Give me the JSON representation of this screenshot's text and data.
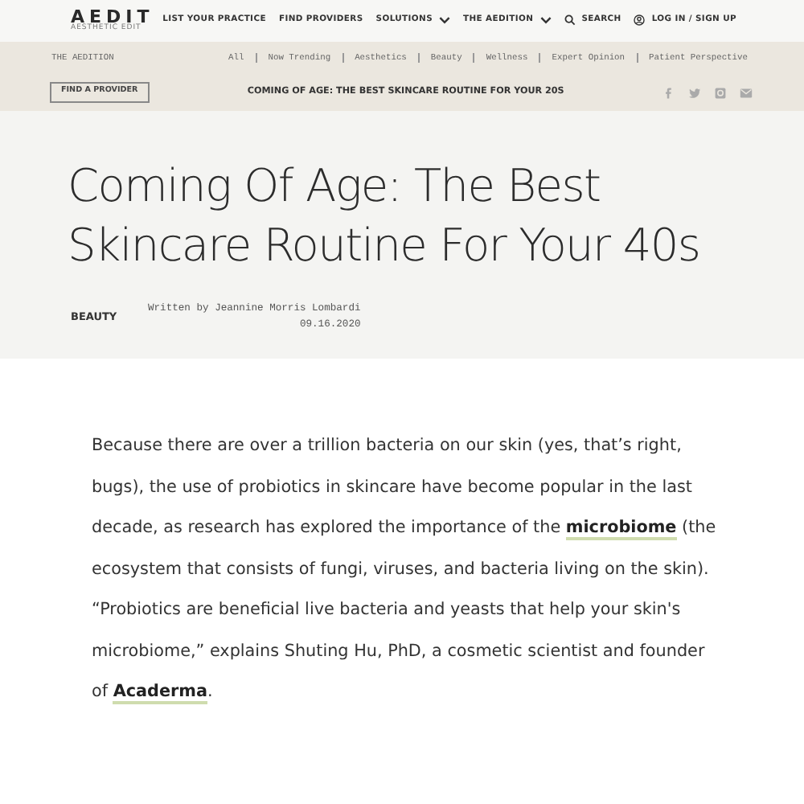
{
  "logo": {
    "name": "AEDIT",
    "tagline": "AESTHETIC EDIT"
  },
  "nav": [
    {
      "label": "LIST YOUR PRACTICE",
      "kind": "link"
    },
    {
      "label": "FIND PROVIDERS",
      "kind": "link"
    },
    {
      "label": "SOLUTIONS",
      "kind": "dropdown"
    },
    {
      "label": "THE AEDITION",
      "kind": "dropdown"
    },
    {
      "label": "SEARCH",
      "kind": "search"
    },
    {
      "label": "LOG IN / SIGN UP",
      "kind": "account"
    }
  ],
  "section": "THE AEDITION",
  "categories": [
    "All",
    "Now Trending",
    "Aesthetics",
    "Beauty",
    "Wellness",
    "Expert Opinion",
    "Patient Perspective"
  ],
  "find_button": "FIND A PROVIDER",
  "sticky_title": "COMING OF AGE: THE BEST SKINCARE ROUTINE FOR YOUR 20S",
  "title": "Coming Of Age:  The Best Skincare Routine For Your 40s",
  "tag": "BEAUTY",
  "byline": "Written by Jeannine Morris Lombardi",
  "date": "09.16.2020",
  "body": [
    {
      "kind": "text",
      "text": "Because there are over a trillion bacteria on our skin (yes, that’s right, bugs), the use of probiotics in skincare have become popular in the last decade, as research has explored the importance of the "
    },
    {
      "kind": "link",
      "text": "microbiome"
    },
    {
      "kind": "text",
      "text": " (the ecosystem that consists of fungi, viruses, and bacteria living on the skin). “Probiotics are beneficial live bacteria and yeasts that help your skin's microbiome,” explains Shuting Hu, PhD, a cosmetic scientist and founder of "
    },
    {
      "kind": "link",
      "text": "Acaderma"
    },
    {
      "kind": "text",
      "text": "."
    }
  ]
}
